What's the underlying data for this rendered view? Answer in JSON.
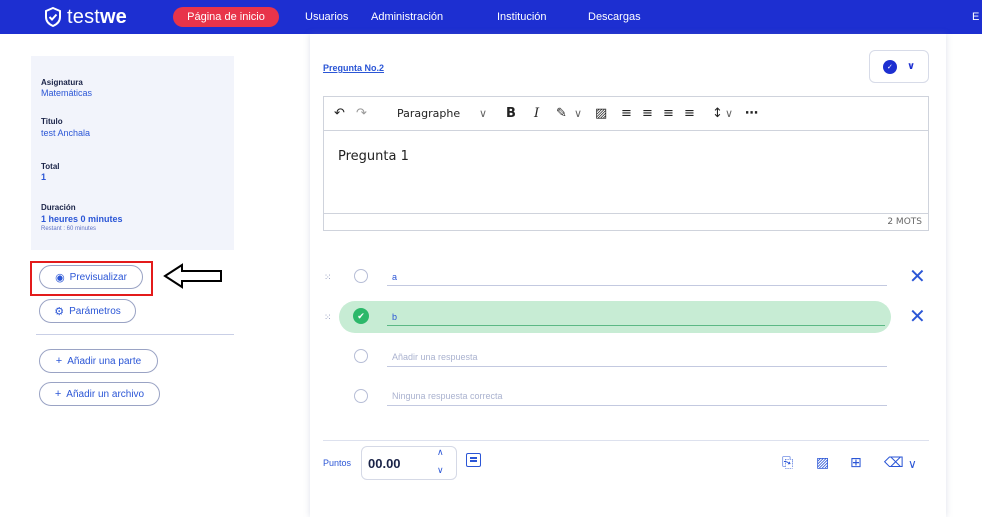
{
  "app": {
    "logo_text_1": "test",
    "logo_text_2": "we"
  },
  "nav": {
    "active": "Página de inicio",
    "items": [
      "Usuarios",
      "Administración",
      "Institución",
      "Descargas"
    ],
    "edge": "E"
  },
  "info": {
    "subject_label": "Asignatura",
    "subject_value": "Matemáticas",
    "title_label": "Titulo",
    "title_value": "test Anchala",
    "total_label": "Total",
    "total_value": "1",
    "duration_label": "Duración",
    "duration_value": "1 heures 0 minutes",
    "remaining": "Restant : 60 minutes"
  },
  "sidebar_buttons": {
    "preview": "Previsualizar",
    "settings": "Parámetros",
    "add_part": "Añadir una parte",
    "add_file": "Añadir un archivo"
  },
  "question": {
    "title": "Pregunta No.2",
    "editor_text": "Pregunta 1",
    "word_count": "2 MOTS",
    "block_format": "Paragraphe"
  },
  "answers": [
    {
      "text": "a",
      "checked": false
    },
    {
      "text": "b",
      "checked": true
    }
  ],
  "answer_placeholders": {
    "add": "Añadir una respuesta",
    "none": "Ninguna respuesta correcta"
  },
  "footer": {
    "points_label": "Puntos",
    "points_value": "00.00"
  },
  "colors": {
    "nav_bg": "#1d2fd1",
    "nav_active": "#e8344a",
    "accent": "#2b56d6",
    "correct_bg": "#c7ecd4",
    "correct_check": "#2cb86a",
    "highlight_box": "#e31b1b"
  }
}
